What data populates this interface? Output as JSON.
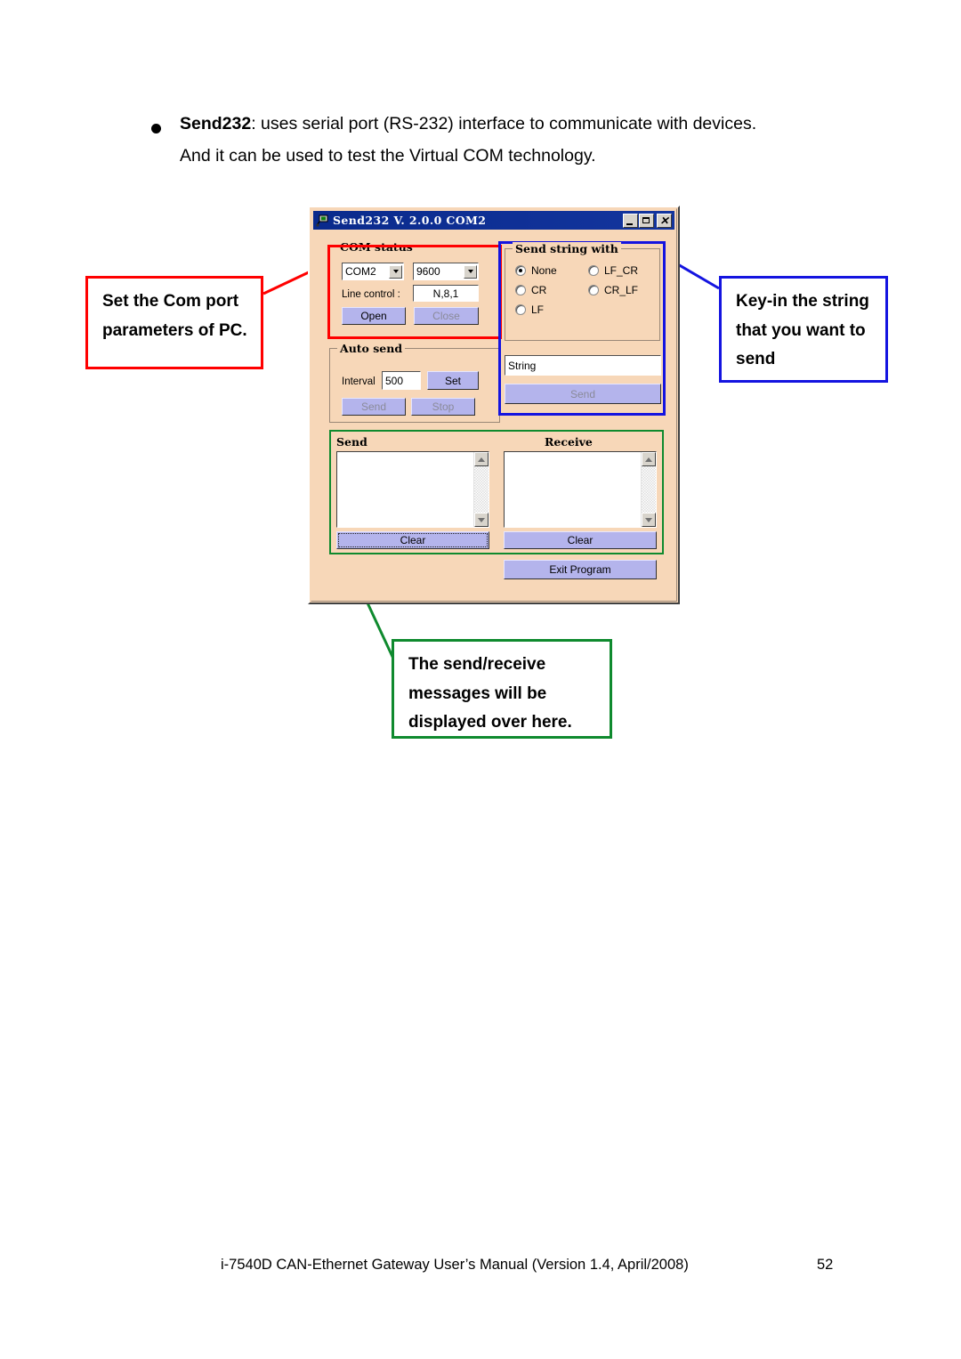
{
  "page": {
    "intro": {
      "bullet_icon": "bullet-icon",
      "line1_bold": "Send232",
      "line1_rest": ": uses serial port (RS-232) interface to communicate with devices.",
      "line2": "And it can be used to test the Virtual COM technology."
    },
    "footer": {
      "text": "i-7540D CAN-Ethernet Gateway User’s Manual (Version 1.4, April/2008)",
      "page_number": "52"
    }
  },
  "callouts": {
    "com_port": {
      "text": "Set the Com port parameters of PC.",
      "color": "#ff0000"
    },
    "key_in": {
      "text": "Key-in the string that you want to send",
      "color": "#1414e0"
    },
    "messages": {
      "text": "The send/receive messages will be displayed over here.",
      "color": "#0f8a2e"
    }
  },
  "window": {
    "title": "Send232 V. 2.0.0 COM2",
    "icon": "app-icon",
    "controls": {
      "minimize": "minimize-icon",
      "maximize": "maximize-icon",
      "close": "close-icon"
    },
    "background_color": "#f7d7b8",
    "button_color": "#b4b4ec",
    "com_status": {
      "title": "COM status",
      "port_value": "COM2",
      "baud_value": "9600",
      "line_control_label": "Line control :",
      "line_control_value": "N,8,1",
      "open_label": "Open",
      "close_label": "Close",
      "open_enabled": true,
      "close_enabled": false
    },
    "auto_send": {
      "title": "Auto send",
      "interval_label": "Interval",
      "interval_value": "500",
      "set_label": "Set",
      "send_label": "Send",
      "stop_label": "Stop",
      "set_enabled": true,
      "send_enabled": false,
      "stop_enabled": false
    },
    "send_string_with": {
      "title": "Send string with",
      "options": [
        {
          "label": "None",
          "selected": true
        },
        {
          "label": "CR",
          "selected": false
        },
        {
          "label": "LF",
          "selected": false
        },
        {
          "label": "LF_CR",
          "selected": false
        },
        {
          "label": "CR_LF",
          "selected": false
        }
      ],
      "string_value": "String",
      "send_label": "Send",
      "send_enabled": false
    },
    "message_panel": {
      "send_header": "Send",
      "receive_header": "Receive",
      "send_text": "",
      "receive_text": "",
      "send_clear_label": "Clear",
      "receive_clear_label": "Clear"
    },
    "exit_label": "Exit Program"
  }
}
